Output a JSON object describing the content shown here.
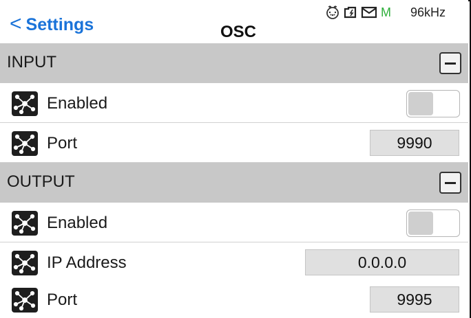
{
  "header": {
    "back_label": "Settings",
    "back_glyph": "<",
    "title": "OSC",
    "status": {
      "icons": [
        "midi-port-icon",
        "sd-card-icon",
        "mail-icon"
      ],
      "m_label": "M",
      "sample_rate": "96kHz"
    }
  },
  "input": {
    "title": "INPUT",
    "rows": [
      {
        "label": "Enabled",
        "icon": "network-icon",
        "type": "toggle",
        "value": false
      },
      {
        "label": "Port",
        "icon": "network-icon",
        "type": "field",
        "value": "9990"
      }
    ]
  },
  "output": {
    "title": "OUTPUT",
    "rows": [
      {
        "label": "Enabled",
        "icon": "network-icon",
        "type": "toggle",
        "value": false
      },
      {
        "label": "IP Address",
        "icon": "network-icon",
        "type": "field",
        "value": "0.0.0.0"
      },
      {
        "label": "Port",
        "icon": "network-icon",
        "type": "field",
        "value": "9995"
      }
    ]
  },
  "colors": {
    "accent": "#1a73d9",
    "section_bg": "#c8c8c8",
    "status_m": "#2eae3a"
  }
}
